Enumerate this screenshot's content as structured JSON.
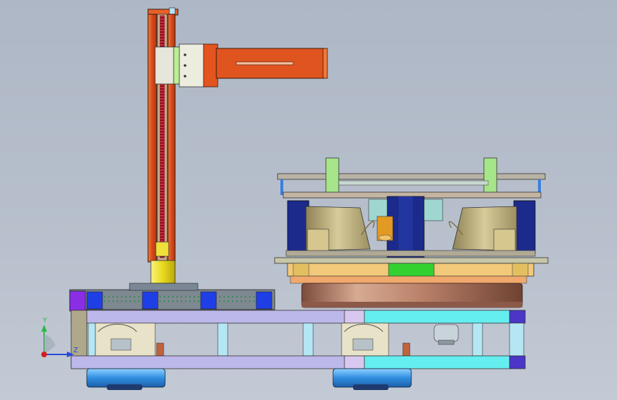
{
  "viewport": {
    "background_top": "#aeb7c6",
    "background_bottom": "#c3cad5"
  },
  "triad": {
    "y_label": "Y",
    "z_label": "Z",
    "y_color": "#2fb84a",
    "z_color": "#2a4bd6",
    "origin_color": "#d21f1f"
  },
  "colors": {
    "column_orange": "#e0521e",
    "arm_orange": "#e0541f",
    "leadscrew_red": "#d82a3a",
    "carriage_green": "#d3f0a8",
    "carriage_grey": "#e4e4dc",
    "base_purple": "#b9b4e8",
    "base_cyan": "#63eef0",
    "wheel_blue": "#3f9fe8",
    "motor_yellow": "#f0e42e",
    "platform_khaki": "#c8b98a",
    "hub_navy": "#1c2a8c",
    "turntable_copper": "#b07a60",
    "green_block": "#9fe08a"
  }
}
